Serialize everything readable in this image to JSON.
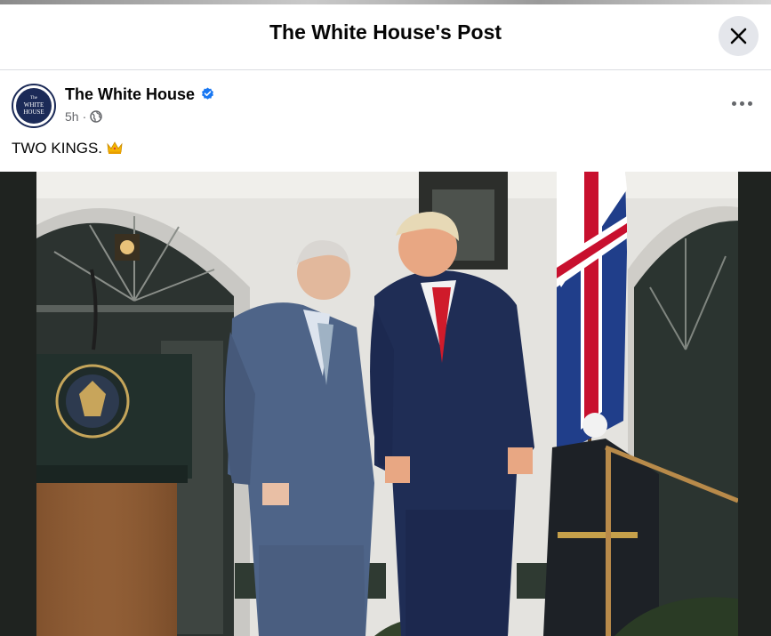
{
  "modal": {
    "title": "The White House's Post"
  },
  "post": {
    "author": "The White House",
    "avatar_text_line1": "The",
    "avatar_text_line2": "WHITE",
    "avatar_text_line3": "HOUSE",
    "time": "5h",
    "separator": "·",
    "audience_icon": "globe-icon",
    "verified_icon": "verified-badge-icon",
    "text": "TWO KINGS.",
    "emoji_icon": "crown-icon"
  },
  "colors": {
    "verified": "#1877f2",
    "modal_bg": "#ffffff",
    "close_button_bg": "#e4e6eb"
  }
}
